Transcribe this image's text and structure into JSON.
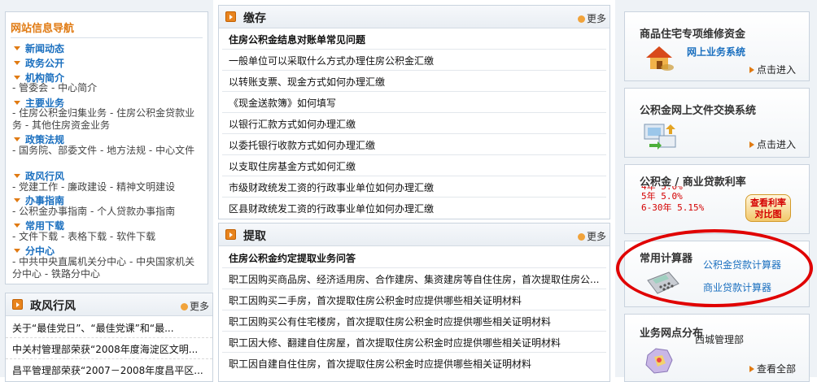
{
  "left": {
    "top_fragment": "",
    "nav_title": "网站信息导航",
    "sections": [
      {
        "label": "新闻动态",
        "links": []
      },
      {
        "label": "政务公开",
        "links": []
      },
      {
        "label": "机构简介",
        "links": "- 管委会   - 中心简介"
      },
      {
        "label": "主要业务",
        "links": "- 住房公积金归集业务   - 住房公积金贷款业务   - 其他住房资金业务"
      },
      {
        "label": "政策法规",
        "links": "- 国务院、部委文件   - 地方法规   - 中心文件"
      },
      {
        "label": "政风行风",
        "links": "- 党建工作   - 廉政建设   - 精神文明建设"
      },
      {
        "label": "办事指南",
        "links": "- 公积金办事指南   - 个人贷款办事指南"
      },
      {
        "label": "常用下载",
        "links": "- 文件下载   - 表格下载   - 软件下载"
      },
      {
        "label": "分中心",
        "links": "- 中共中央直属机关分中心   - 中央国家机关分中心   - 铁路分中心"
      }
    ],
    "news_box": {
      "title": "政风行风",
      "more": "更多",
      "items": [
        "关于“最佳党日”、“最佳党课”和“最...",
        "中关村管理部荣获“2008年度海淀区文明...",
        "昌平管理部荣获“2007－2008年度昌平区..."
      ]
    }
  },
  "middle": {
    "pay": {
      "title": "缴存",
      "more": "更多",
      "items": [
        "住房公积金结息对账单常见问题",
        "一般单位可以采取什么方式办理住房公积金汇缴",
        "以转账支票、现金方式如何办理汇缴",
        "《现金送款簿》如何填写",
        "以银行汇款方式如何办理汇缴",
        "以委托银行收款方式如何办理汇缴",
        "以支取住房基金方式如何汇缴",
        "市级财政统发工资的行政事业单位如何办理汇缴",
        "区县财政统发工资的行政事业单位如何办理汇缴"
      ]
    },
    "withdraw": {
      "title": "提取",
      "more": "更多",
      "items": [
        "住房公积金约定提取业务问答",
        "职工因购买商品房、经济适用房、合作建房、集资建房等自住住房，首次提取住房公...",
        "职工因购买二手房，首次提取住房公积金时应提供哪些相关证明材料",
        "职工因购买公有住宅楼房，首次提取住房公积金时应提供哪些相关证明材料",
        "职工因大修、翻建自住房屋，首次提取住房公积金时应提供哪些相关证明材料",
        "职工因自建自住住房，首次提取住房公积金时应提供哪些相关证明材料"
      ]
    }
  },
  "right": {
    "maint": {
      "title": "商品住宅专项维修资金",
      "subtitle": "网上业务系统",
      "enter": "点击进入"
    },
    "exchange": {
      "title": "公积金网上文件交换系统",
      "enter": "点击进入"
    },
    "rates": {
      "title": "公积金 / 商业贷款利率",
      "lines": [
        "4年 5.0%",
        "5年 5.0%",
        "6-30年 5.15%"
      ],
      "compare_button": "查看利率对比图"
    },
    "calculator": {
      "title": "常用计算器",
      "link1": "公积金贷款计算器",
      "link2": "商业贷款计算器"
    },
    "outlets": {
      "title": "业务网点分布",
      "name": "西城管理部",
      "view_all": "查看全部"
    }
  },
  "colors": {
    "accent": "#e07a12",
    "link_blue": "#1a6fbf",
    "rate_red": "#d40000",
    "annotation_red": "#e00000"
  }
}
